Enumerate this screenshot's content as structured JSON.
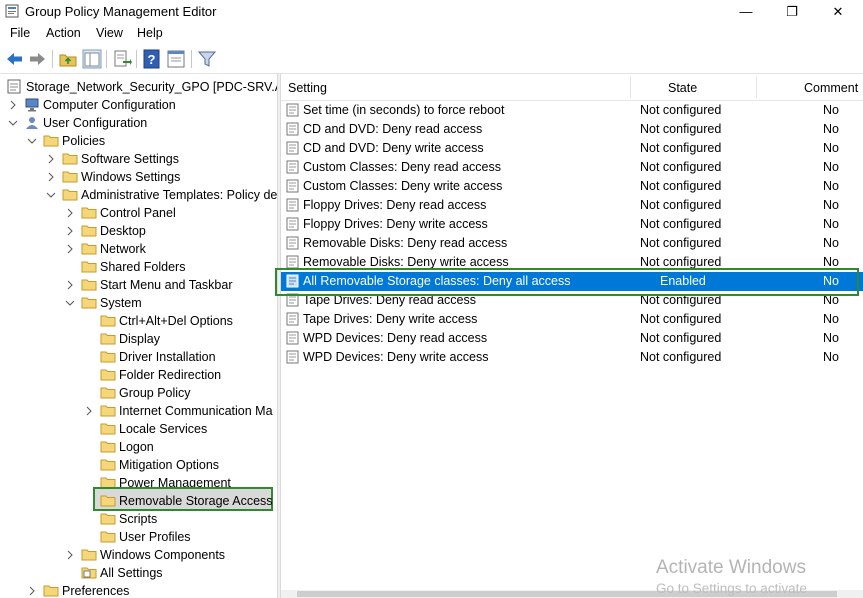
{
  "window": {
    "title": "Group Policy Management Editor",
    "controls": {
      "minimize": "—",
      "maximize": "❐",
      "close": "✕"
    }
  },
  "menu": [
    "File",
    "Action",
    "View",
    "Help"
  ],
  "toolbar": {
    "buttons": [
      "back-arrow-icon",
      "forward-arrow-icon",
      "up-folder-icon",
      "show-hide-tree-icon",
      "export-list-icon",
      "help-icon",
      "properties-icon",
      "filter-icon"
    ]
  },
  "tree": {
    "root": "Storage_Network_Security_GPO [PDC-SRV.AAA",
    "computer_config": "Computer Configuration",
    "user_config": "User Configuration",
    "policies": "Policies",
    "software_settings": "Software Settings",
    "windows_settings": "Windows Settings",
    "admin_templates": "Administrative Templates: Policy def",
    "control_panel": "Control Panel",
    "desktop": "Desktop",
    "network": "Network",
    "shared_folders": "Shared Folders",
    "start_menu": "Start Menu and Taskbar",
    "system": "System",
    "cad_options": "Ctrl+Alt+Del Options",
    "display": "Display",
    "driver_installation": "Driver Installation",
    "folder_redirection": "Folder Redirection",
    "group_policy": "Group Policy",
    "internet_comm": "Internet Communication Ma",
    "locale_services": "Locale Services",
    "logon": "Logon",
    "mitigation_options": "Mitigation Options",
    "power_management": "Power Management",
    "removable_storage": "Removable Storage Access",
    "scripts": "Scripts",
    "user_profiles": "User Profiles",
    "windows_components": "Windows Components",
    "all_settings": "All Settings",
    "preferences": "Preferences"
  },
  "list": {
    "columns": {
      "setting": "Setting",
      "state": "State",
      "comment": "Comment"
    },
    "rows": [
      {
        "setting": "Set time (in seconds) to force reboot",
        "state": "Not configured",
        "comment": "No"
      },
      {
        "setting": "CD and DVD: Deny read access",
        "state": "Not configured",
        "comment": "No"
      },
      {
        "setting": "CD and DVD: Deny write access",
        "state": "Not configured",
        "comment": "No"
      },
      {
        "setting": "Custom Classes: Deny read access",
        "state": "Not configured",
        "comment": "No"
      },
      {
        "setting": "Custom Classes: Deny write access",
        "state": "Not configured",
        "comment": "No"
      },
      {
        "setting": "Floppy Drives: Deny read access",
        "state": "Not configured",
        "comment": "No"
      },
      {
        "setting": "Floppy Drives: Deny write access",
        "state": "Not configured",
        "comment": "No"
      },
      {
        "setting": "Removable Disks: Deny read access",
        "state": "Not configured",
        "comment": "No"
      },
      {
        "setting": "Removable Disks: Deny write access",
        "state": "Not configured",
        "comment": "No"
      },
      {
        "setting": "All Removable Storage classes: Deny all access",
        "state": "Enabled",
        "comment": "No"
      },
      {
        "setting": "Tape Drives: Deny read access",
        "state": "Not configured",
        "comment": "No"
      },
      {
        "setting": "Tape Drives: Deny write access",
        "state": "Not configured",
        "comment": "No"
      },
      {
        "setting": "WPD Devices: Deny read access",
        "state": "Not configured",
        "comment": "No"
      },
      {
        "setting": "WPD Devices: Deny write access",
        "state": "Not configured",
        "comment": "No"
      }
    ]
  },
  "watermark": {
    "line1": "Activate Windows",
    "line2": "Go to Settings to activate"
  },
  "colors": {
    "selection": "#0078d7",
    "highlight_box": "#2f8a2f",
    "folder": "#e8c25a"
  }
}
